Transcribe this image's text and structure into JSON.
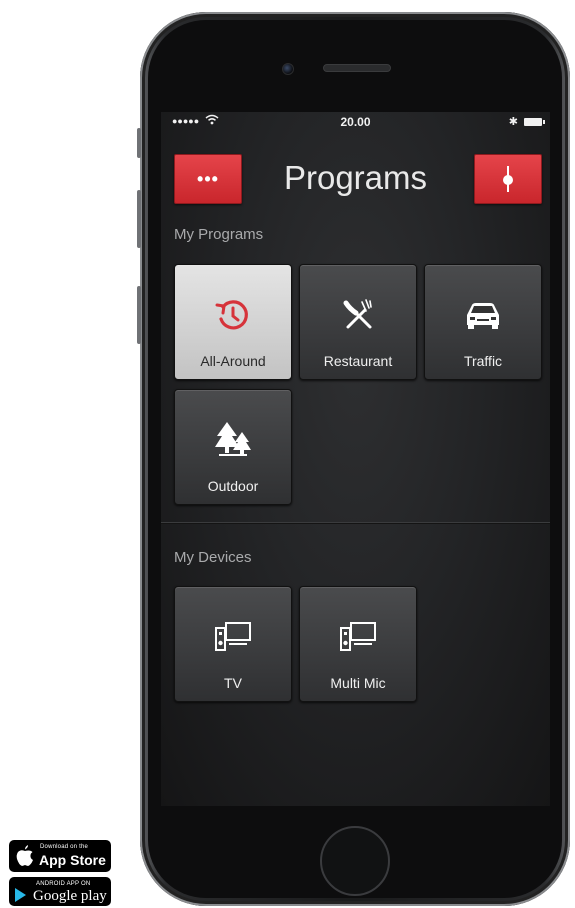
{
  "status_bar": {
    "signal": "●●●●●",
    "time": "20.00",
    "bluetooth": "✱"
  },
  "header": {
    "menu_label": "•••",
    "title": "Programs"
  },
  "my_programs": {
    "heading": "My Programs",
    "items": [
      {
        "label": "All-Around",
        "icon": "all-around-icon",
        "selected": true
      },
      {
        "label": "Restaurant",
        "icon": "restaurant-icon",
        "selected": false
      },
      {
        "label": "Traffic",
        "icon": "car-icon",
        "selected": false
      },
      {
        "label": "Outdoor",
        "icon": "trees-icon",
        "selected": false
      }
    ]
  },
  "my_devices": {
    "heading": "My Devices",
    "items": [
      {
        "label": "TV",
        "icon": "tv-device-icon"
      },
      {
        "label": "Multi Mic",
        "icon": "multi-mic-icon"
      }
    ]
  },
  "badges": {
    "appstore_small": "Download on the",
    "appstore_big": "App Store",
    "gplay_small": "ANDROID APP ON",
    "gplay_big": "Google play"
  },
  "colors": {
    "accent_red": "#d6333a",
    "selected_tile": "#d8d8d8",
    "tile": "#3a3b3d"
  }
}
